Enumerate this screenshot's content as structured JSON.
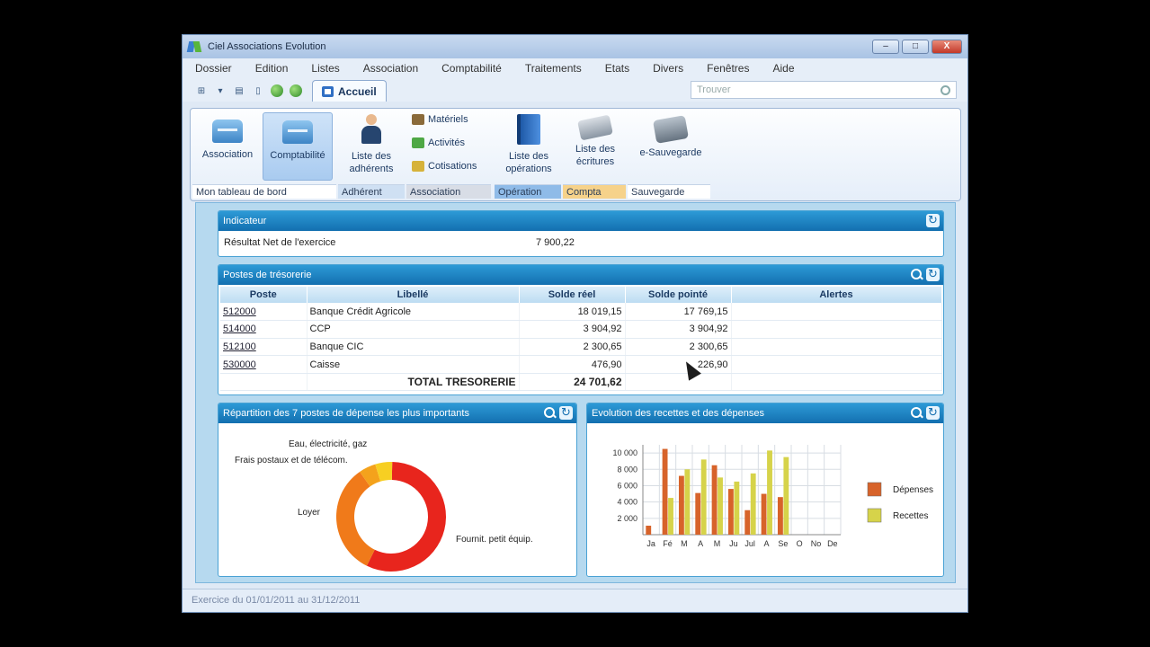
{
  "window": {
    "title": "Ciel Associations Evolution",
    "controls": [
      "–",
      "□",
      "X"
    ]
  },
  "menu": [
    "Dossier",
    "Edition",
    "Listes",
    "Association",
    "Comptabilité",
    "Traitements",
    "Etats",
    "Divers",
    "Fenêtres",
    "Aide"
  ],
  "tab": {
    "label": "Accueil"
  },
  "search": {
    "placeholder": "Trouver"
  },
  "ribbon": {
    "buttons": {
      "association": "Association",
      "comptabilite": "Comptabilité",
      "adherents": "Liste des adhérents",
      "operations": "Liste des opérations",
      "ecritures": "Liste des écritures",
      "sauvegarde": "e-Sauvegarde"
    },
    "small_items": [
      "Matériels",
      "Activités",
      "Cotisations"
    ],
    "groups": {
      "tableau": "Mon tableau de bord",
      "adherent": "Adhérent",
      "association": "Association",
      "operation": "Opération",
      "compta": "Compta",
      "sauvegarde": "Sauvegarde"
    },
    "group_colors": {
      "adherent": "#cfe0f3",
      "association": "#d8dde6",
      "operation": "#8fbbe8",
      "compta": "#f6d28a",
      "sauvegarde": "#ffffff"
    }
  },
  "indicateur": {
    "title": "Indicateur",
    "label": "Résultat Net de l'exercice",
    "value": "7 900,22"
  },
  "tresorerie": {
    "title": "Postes de trésorerie",
    "columns": [
      "Poste",
      "Libellé",
      "Solde réel",
      "Solde pointé",
      "Alertes"
    ],
    "rows": [
      {
        "poste": "512000",
        "libelle": "Banque Crédit Agricole",
        "reel": "18 019,15",
        "pointe": "17 769,15"
      },
      {
        "poste": "514000",
        "libelle": "CCP",
        "reel": "3 904,92",
        "pointe": "3 904,92"
      },
      {
        "poste": "512100",
        "libelle": "Banque CIC",
        "reel": "2 300,65",
        "pointe": "2 300,65"
      },
      {
        "poste": "530000",
        "libelle": "Caisse",
        "reel": "476,90",
        "pointe": "226,90"
      }
    ],
    "total_label": "TOTAL TRESORERIE",
    "total_value": "24 701,62"
  },
  "donut_panel": {
    "title": "Répartition des 7 postes de dépense les plus importants",
    "chart_data": {
      "type": "pie",
      "slices": [
        {
          "label": "Fournit. petit équip.",
          "value": 57,
          "color": "#e8251d"
        },
        {
          "label": "Loyer",
          "value": 33,
          "color": "#f07a1a"
        },
        {
          "label": "Frais postaux et de télécom.",
          "value": 5,
          "color": "#f4a21c"
        },
        {
          "label": "Eau, électricité, gaz",
          "value": 5,
          "color": "#f7cf22"
        }
      ]
    }
  },
  "bar_panel": {
    "title": "Evolution des recettes et des dépenses",
    "chart_data": {
      "type": "bar",
      "categories": [
        "Ja",
        "Fé",
        "M",
        "A",
        "M",
        "Ju",
        "Jul",
        "A",
        "Se",
        "O",
        "No",
        "De"
      ],
      "series": [
        {
          "name": "Dépenses",
          "color": "#d7632a",
          "values": [
            1100,
            10500,
            7200,
            5100,
            8500,
            5600,
            3000,
            5000,
            4600,
            0,
            0,
            0
          ]
        },
        {
          "name": "Recettes",
          "color": "#d6d34a",
          "values": [
            0,
            4500,
            8000,
            9200,
            7000,
            6500,
            7500,
            10300,
            9500,
            0,
            0,
            0
          ]
        }
      ],
      "yticks": [
        "10 000",
        "8 000",
        "6 000",
        "4 000",
        "2 000"
      ],
      "ylim": [
        0,
        11000
      ],
      "legend": "right",
      "grid": true
    }
  },
  "status": {
    "text": "Exercice du 01/01/2011 au 31/12/2011"
  }
}
